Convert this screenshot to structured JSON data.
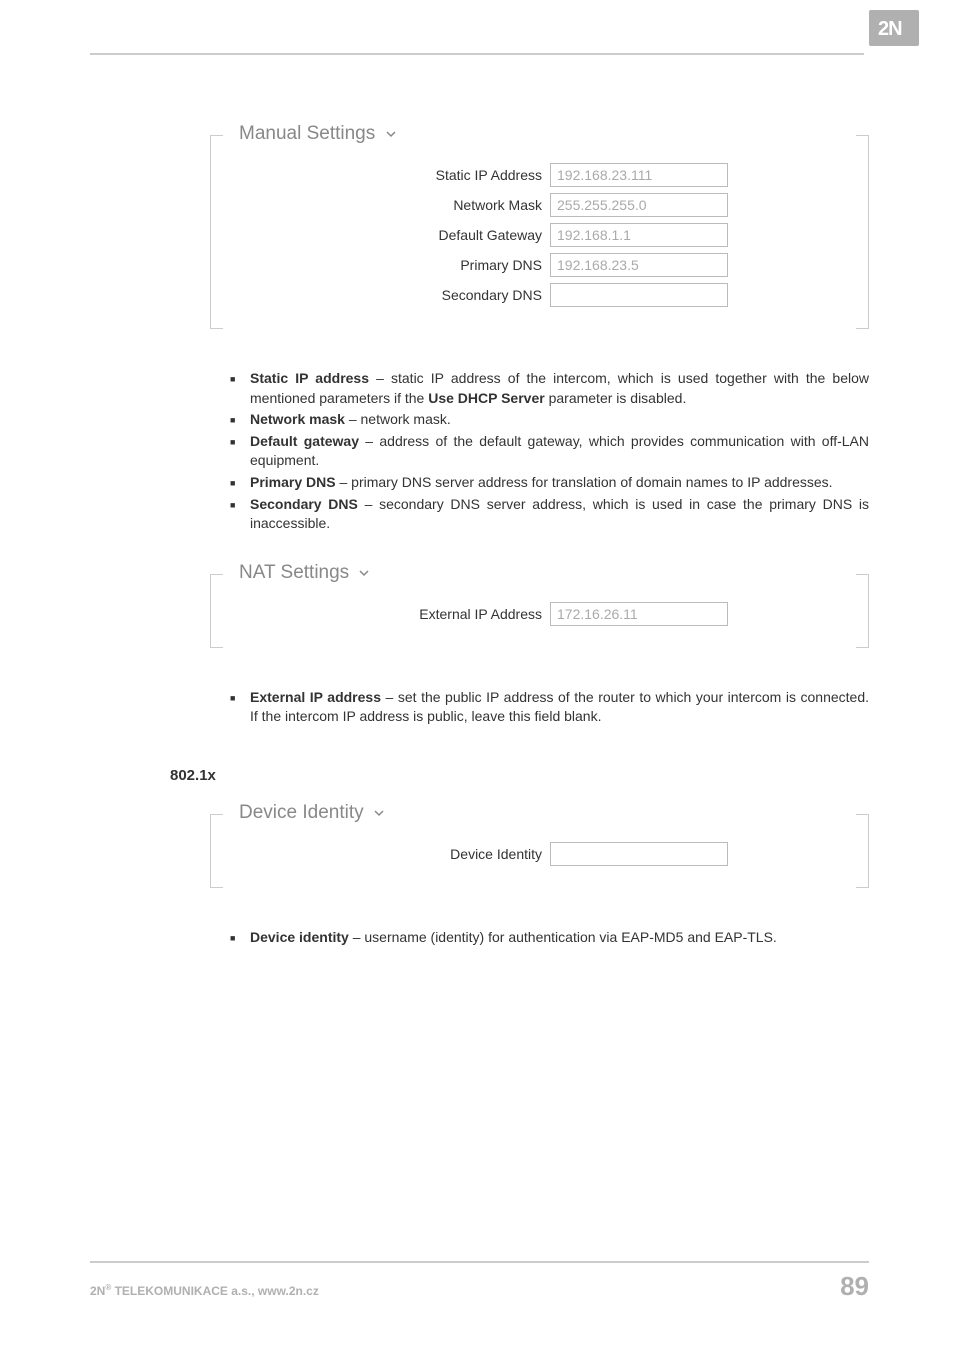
{
  "logo_text": "2N",
  "manual_settings": {
    "title": "Manual Settings",
    "fields": {
      "static_ip": {
        "label": "Static IP Address",
        "value": "192.168.23.111"
      },
      "netmask": {
        "label": "Network Mask",
        "value": "255.255.255.0"
      },
      "gateway": {
        "label": "Default Gateway",
        "value": "192.168.1.1"
      },
      "primary_dns": {
        "label": "Primary DNS",
        "value": "192.168.23.5"
      },
      "secondary_dns": {
        "label": "Secondary DNS",
        "value": ""
      }
    }
  },
  "manual_desc": {
    "static_ip": {
      "term": "Static IP address",
      "text": " – static IP address of the intercom, which is used together with the below mentioned parameters if the ",
      "term2": "Use DHCP Server",
      "text2": " parameter is disabled."
    },
    "netmask": {
      "term": "Network mask",
      "text": " – network mask."
    },
    "gateway": {
      "term": "Default gateway",
      "text": " – address of the default gateway, which provides communication with off-LAN equipment."
    },
    "primary_dns": {
      "term": "Primary DNS",
      "text": " – primary DNS server address for translation of domain names to IP addresses."
    },
    "secondary_dns": {
      "term": "Secondary DNS",
      "text": " – secondary DNS server address, which is used in case the primary DNS is inaccessible."
    }
  },
  "nat_settings": {
    "title": "NAT Settings",
    "fields": {
      "external_ip": {
        "label": "External IP Address",
        "value": "172.16.26.11"
      }
    }
  },
  "nat_desc": {
    "external_ip": {
      "term": "External IP address",
      "text": " – set the public IP address of the router to which your intercom is connected. If the intercom IP address is public, leave this field blank."
    }
  },
  "section_8021x": "802.1x",
  "device_identity": {
    "title": "Device Identity",
    "fields": {
      "device_identity": {
        "label": "Device Identity",
        "value": ""
      }
    }
  },
  "device_identity_desc": {
    "device_identity": {
      "term": "Device identity",
      "text": " – username (identity) for authentication via EAP-MD5 and EAP-TLS."
    }
  },
  "footer": {
    "company_prefix": "2N",
    "company_reg": "®",
    "company_rest": " TELEKOMUNIKACE a.s., www.2n.cz",
    "page": "89"
  }
}
